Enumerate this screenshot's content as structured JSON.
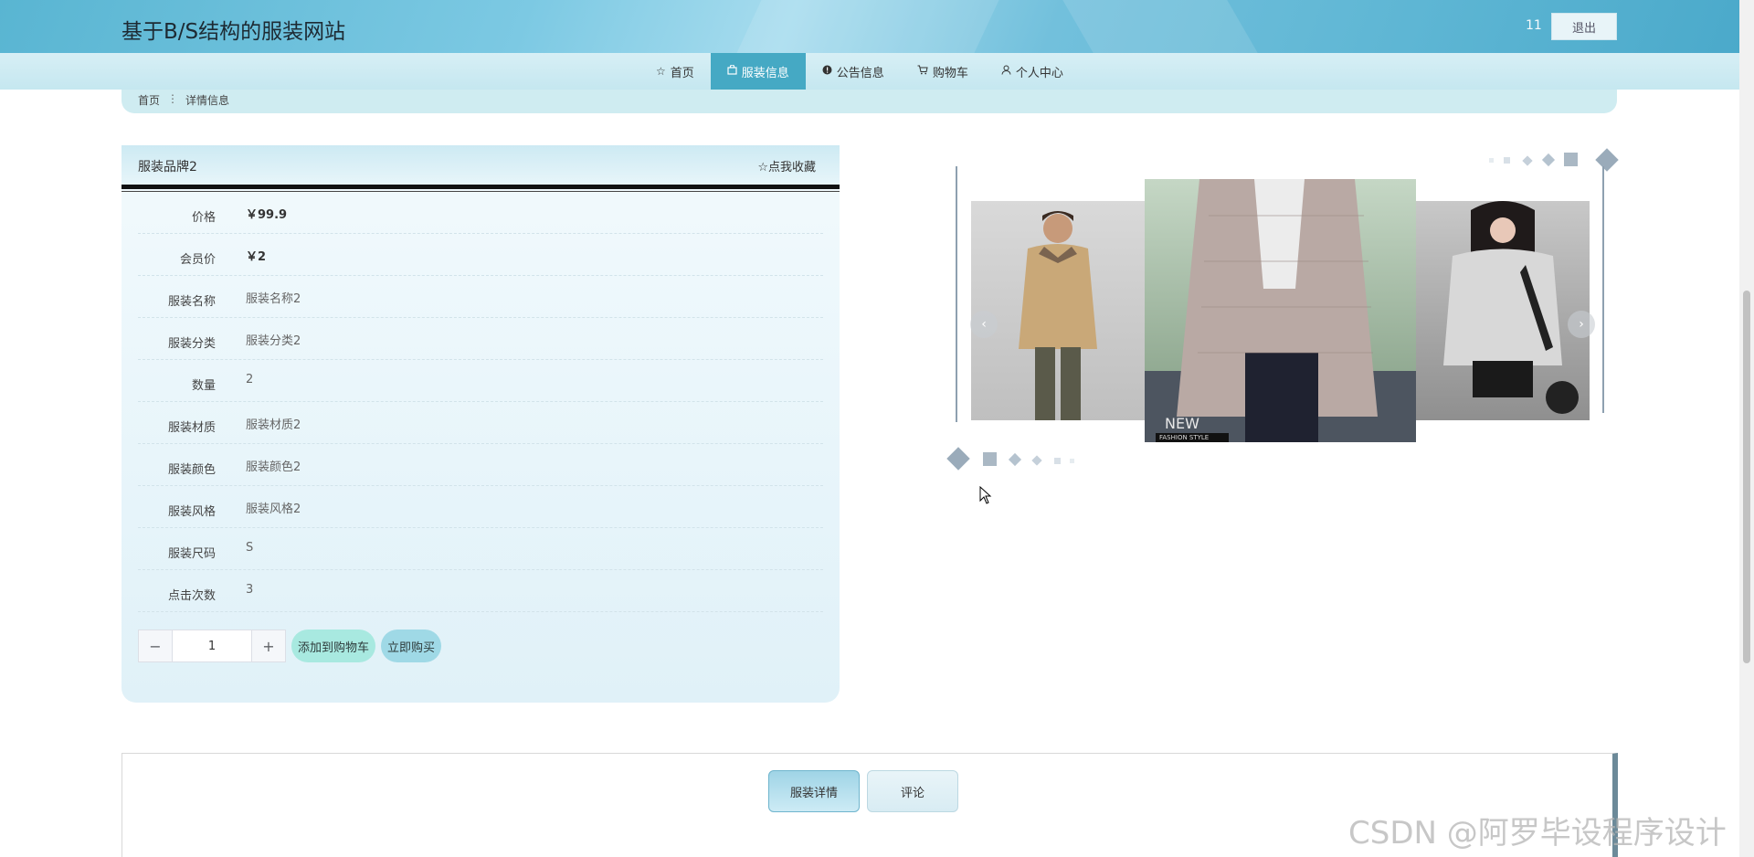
{
  "header": {
    "site_title": "基于B/S结构的服装网站",
    "user_name": "11",
    "logout_label": "退出"
  },
  "nav": {
    "items": [
      {
        "label": "首页",
        "icon": "star-icon"
      },
      {
        "label": "服装信息",
        "icon": "bag-icon"
      },
      {
        "label": "公告信息",
        "icon": "info-icon"
      },
      {
        "label": "购物车",
        "icon": "cart-icon"
      },
      {
        "label": "个人中心",
        "icon": "person-icon"
      }
    ],
    "active_index": 1
  },
  "breadcrumb": {
    "home": "首页",
    "current": "详情信息"
  },
  "product": {
    "title": "服装品牌2",
    "favorite_label": "点我收藏",
    "attributes": [
      {
        "label": "价格",
        "value": "￥99.9"
      },
      {
        "label": "会员价",
        "value": "￥2"
      },
      {
        "label": "服装名称",
        "value": "服装名称2"
      },
      {
        "label": "服装分类",
        "value": "服装分类2"
      },
      {
        "label": "数量",
        "value": "2"
      },
      {
        "label": "服装材质",
        "value": "服装材质2"
      },
      {
        "label": "服装颜色",
        "value": "服装颜色2"
      },
      {
        "label": "服装风格",
        "value": "服装风格2"
      },
      {
        "label": "服装尺码",
        "value": "S"
      },
      {
        "label": "点击次数",
        "value": "3"
      }
    ],
    "quantity": "1",
    "add_to_cart_label": "添加到购物车",
    "buy_now_label": "立即购买"
  },
  "carousel": {
    "slide_badge": "NEW",
    "slide_badge_sub": "FASHION STYLE"
  },
  "tabs": {
    "detail_label": "服装详情",
    "comment_label": "评论"
  },
  "watermark": "CSDN @阿罗毕设程序设计",
  "colors": {
    "accent": "#45a9c4",
    "cart_button": "#a8e9e0",
    "buy_button": "#9fd9e6"
  }
}
